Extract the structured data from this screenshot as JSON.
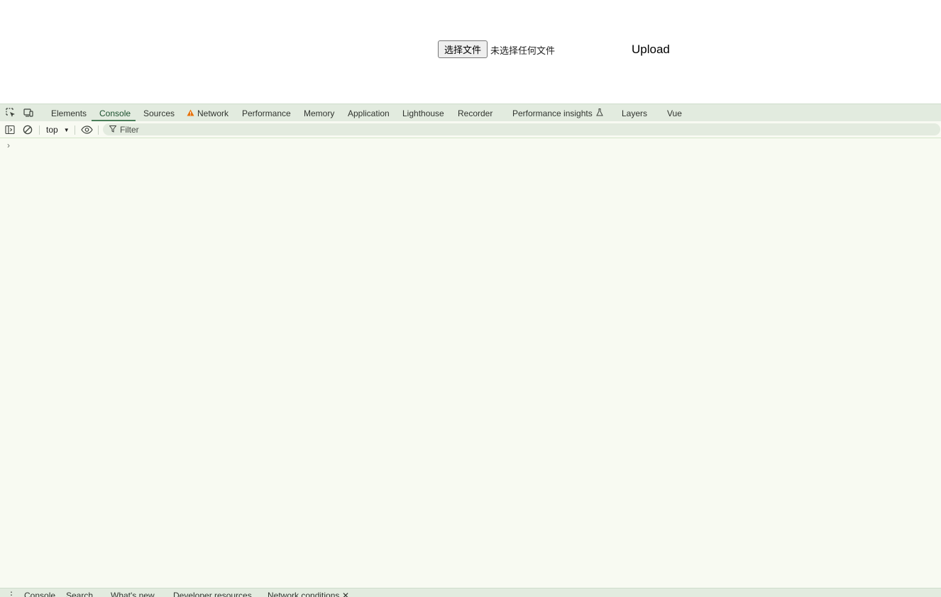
{
  "page": {
    "file_button_label": "选择文件",
    "file_status": "未选择任何文件",
    "upload_label": "Upload"
  },
  "devtools": {
    "tabs": [
      {
        "id": "elements",
        "label": "Elements"
      },
      {
        "id": "console",
        "label": "Console",
        "active": true
      },
      {
        "id": "sources",
        "label": "Sources"
      },
      {
        "id": "network",
        "label": "Network",
        "icon": "warning-icon"
      },
      {
        "id": "performance",
        "label": "Performance"
      },
      {
        "id": "memory",
        "label": "Memory"
      },
      {
        "id": "application",
        "label": "Application"
      },
      {
        "id": "lighthouse",
        "label": "Lighthouse"
      },
      {
        "id": "recorder",
        "label": "Recorder"
      },
      {
        "id": "performance-insights",
        "label": "Performance insights",
        "icon": "flask-icon"
      },
      {
        "id": "layers",
        "label": "Layers"
      },
      {
        "id": "vue",
        "label": "Vue"
      }
    ],
    "console": {
      "context": "top",
      "filter_placeholder": "Filter",
      "prompt": "›"
    },
    "drawer_tabs": [
      {
        "id": "console",
        "label": "Console"
      },
      {
        "id": "search",
        "label": "Search"
      },
      {
        "id": "whats-new",
        "label": "What's new"
      },
      {
        "id": "developer-resources",
        "label": "Developer resources"
      },
      {
        "id": "network-conditions",
        "label": "Network conditions",
        "closable": true
      }
    ],
    "colors": {
      "warning": "#e8710a",
      "tab_active": "#1b4f2d",
      "underline": "#4a7f5a"
    }
  }
}
